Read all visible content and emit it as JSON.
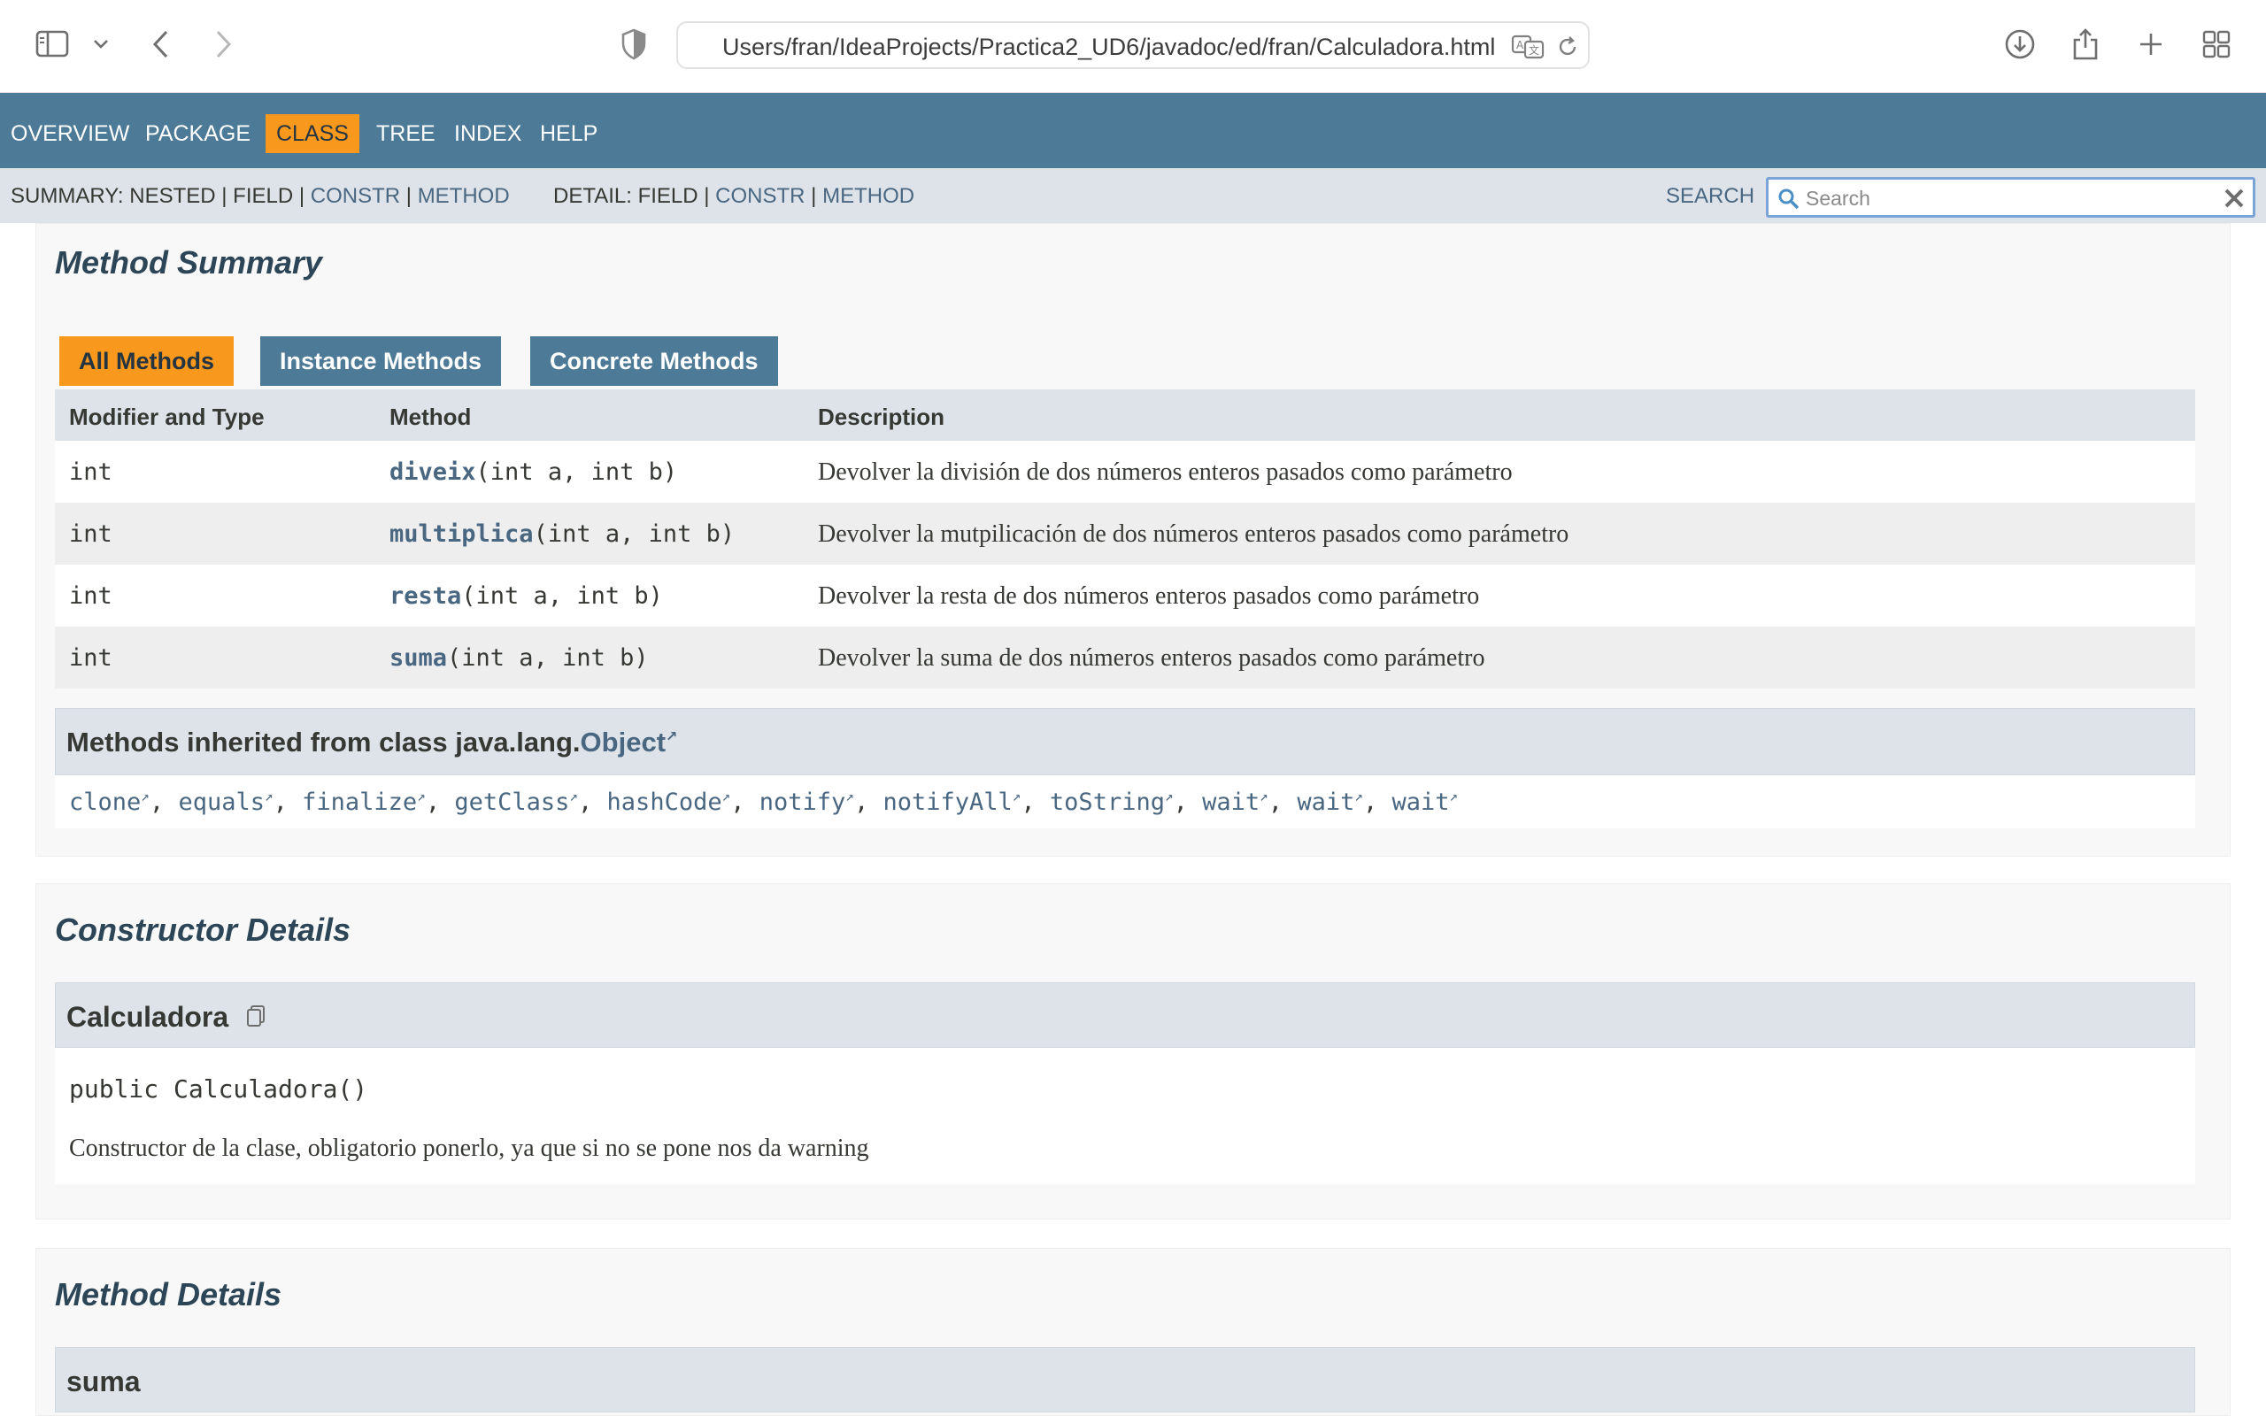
{
  "browser": {
    "url": "Users/fran/IdeaProjects/Practica2_UD6/javadoc/ed/fran/Calculadora.html"
  },
  "nav": {
    "items": [
      "OVERVIEW",
      "PACKAGE",
      "CLASS",
      "TREE",
      "INDEX",
      "HELP"
    ],
    "active": "CLASS"
  },
  "subnav": {
    "summary_prefix": "SUMMARY: NESTED | FIELD | ",
    "summary_constr": "CONSTR",
    "sep": " | ",
    "summary_method": "METHOD",
    "detail_prefix": "DETAIL: FIELD | ",
    "detail_constr": "CONSTR",
    "detail_method": "METHOD",
    "search_label": "SEARCH",
    "search_placeholder": "Search"
  },
  "method_summary": {
    "title": "Method Summary",
    "tabs": [
      "All Methods",
      "Instance Methods",
      "Concrete Methods"
    ],
    "headers": [
      "Modifier and Type",
      "Method",
      "Description"
    ],
    "rows": [
      {
        "type": "int",
        "name": "diveix",
        "params": "(int a, int b)",
        "desc": "Devolver la división de dos números enteros pasados como parámetro"
      },
      {
        "type": "int",
        "name": "multiplica",
        "params": "(int a, int b)",
        "desc": "Devolver la mutpilicación de dos números enteros pasados como parámetro"
      },
      {
        "type": "int",
        "name": "resta",
        "params": "(int a, int b)",
        "desc": "Devolver la resta de dos números enteros pasados como parámetro"
      },
      {
        "type": "int",
        "name": "suma",
        "params": "(int a, int b)",
        "desc": "Devolver la suma de dos números enteros pasados como parámetro"
      }
    ]
  },
  "inherited": {
    "prefix": "Methods inherited from class java.lang.",
    "class_link": "Object",
    "methods": [
      "clone",
      "equals",
      "finalize",
      "getClass",
      "hashCode",
      "notify",
      "notifyAll",
      "toString",
      "wait",
      "wait",
      "wait"
    ]
  },
  "constructor_details": {
    "title": "Constructor Details",
    "name": "Calculadora",
    "signature": "public Calculadora()",
    "description": "Constructor de la clase, obligatorio ponerlo, ya que si no se pone nos da warning"
  },
  "method_details": {
    "title": "Method Details",
    "first_method": "suma"
  },
  "colors": {
    "nav_bg": "#4d7a97",
    "active_tab": "#f8981d",
    "subnav_bg": "#dee3e9",
    "link": "#4a6782"
  }
}
